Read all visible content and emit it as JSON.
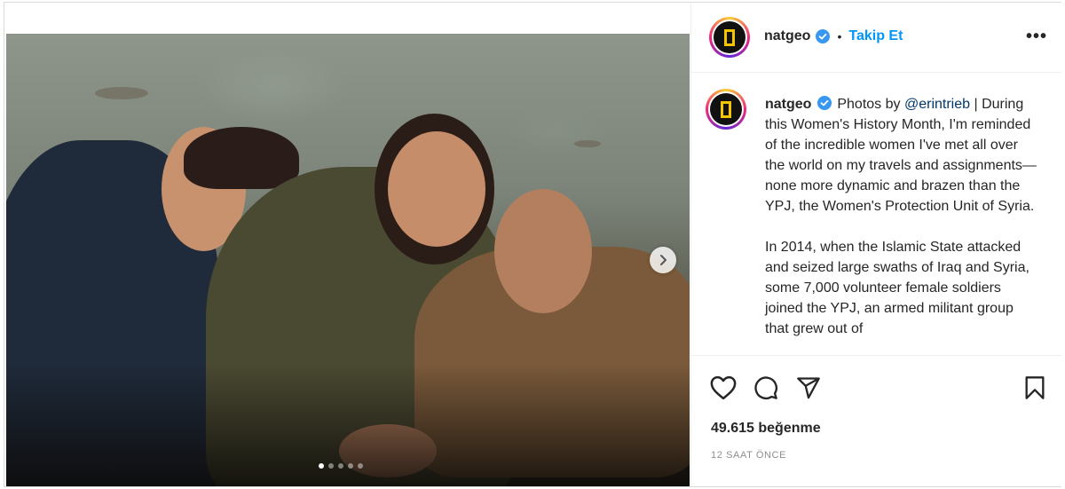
{
  "post": {
    "username": "natgeo",
    "verified": true,
    "follow_label": "Takip Et",
    "bullet": "•",
    "more_label": "•••",
    "caption": {
      "credit_prefix": "Photos by",
      "mention": "@erintrieb",
      "credit_suffix": " |",
      "paragraph1": "During this Women's History Month, I'm reminded of the incredible women I've met all over the world on my travels and assignments—none more dynamic and brazen than the YPJ, the Women's Protection Unit of Syria.",
      "paragraph2": "In 2014, when the Islamic State attacked and seized large swaths of Iraq and Syria, some 7,000 volunteer female soldiers joined the YPJ, an armed militant group that grew out of"
    },
    "likes": "49.615 beğenme",
    "timestamp": "12 SAAT ÖNCE",
    "carousel": {
      "slides": 5,
      "active_index": 0
    }
  },
  "icons": {
    "like": "heart-icon",
    "comment": "comment-icon",
    "share": "share-icon",
    "save": "bookmark-icon",
    "next": "chevron-right-icon",
    "verified": "verified-badge-icon"
  },
  "colors": {
    "accent": "#0095f6",
    "verified": "#3897f0",
    "logo_yellow": "#f5c400",
    "text": "#262626",
    "muted": "#8e8e8e"
  }
}
